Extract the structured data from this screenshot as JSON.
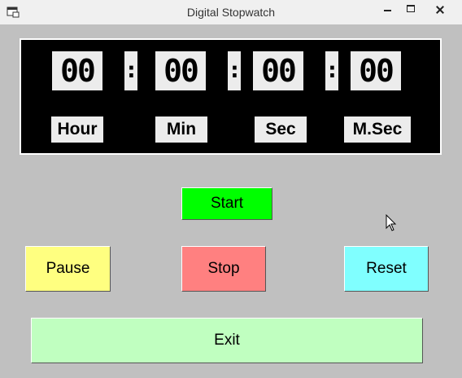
{
  "window": {
    "title": "Digital Stopwatch"
  },
  "display": {
    "hours": "00",
    "minutes": "00",
    "seconds": "00",
    "milliseconds": "00",
    "separator": ":",
    "labels": {
      "hour": "Hour",
      "min": "Min",
      "sec": "Sec",
      "msec": "M.Sec"
    }
  },
  "buttons": {
    "start": "Start",
    "pause": "Pause",
    "stop": "Stop",
    "reset": "Reset",
    "exit": "Exit"
  },
  "colors": {
    "start": "#00ff00",
    "pause": "#ffff80",
    "stop": "#ff8080",
    "reset": "#80ffff",
    "exit": "#c0ffc0",
    "display_bg": "#000000",
    "form_bg": "#c0c0c0"
  }
}
